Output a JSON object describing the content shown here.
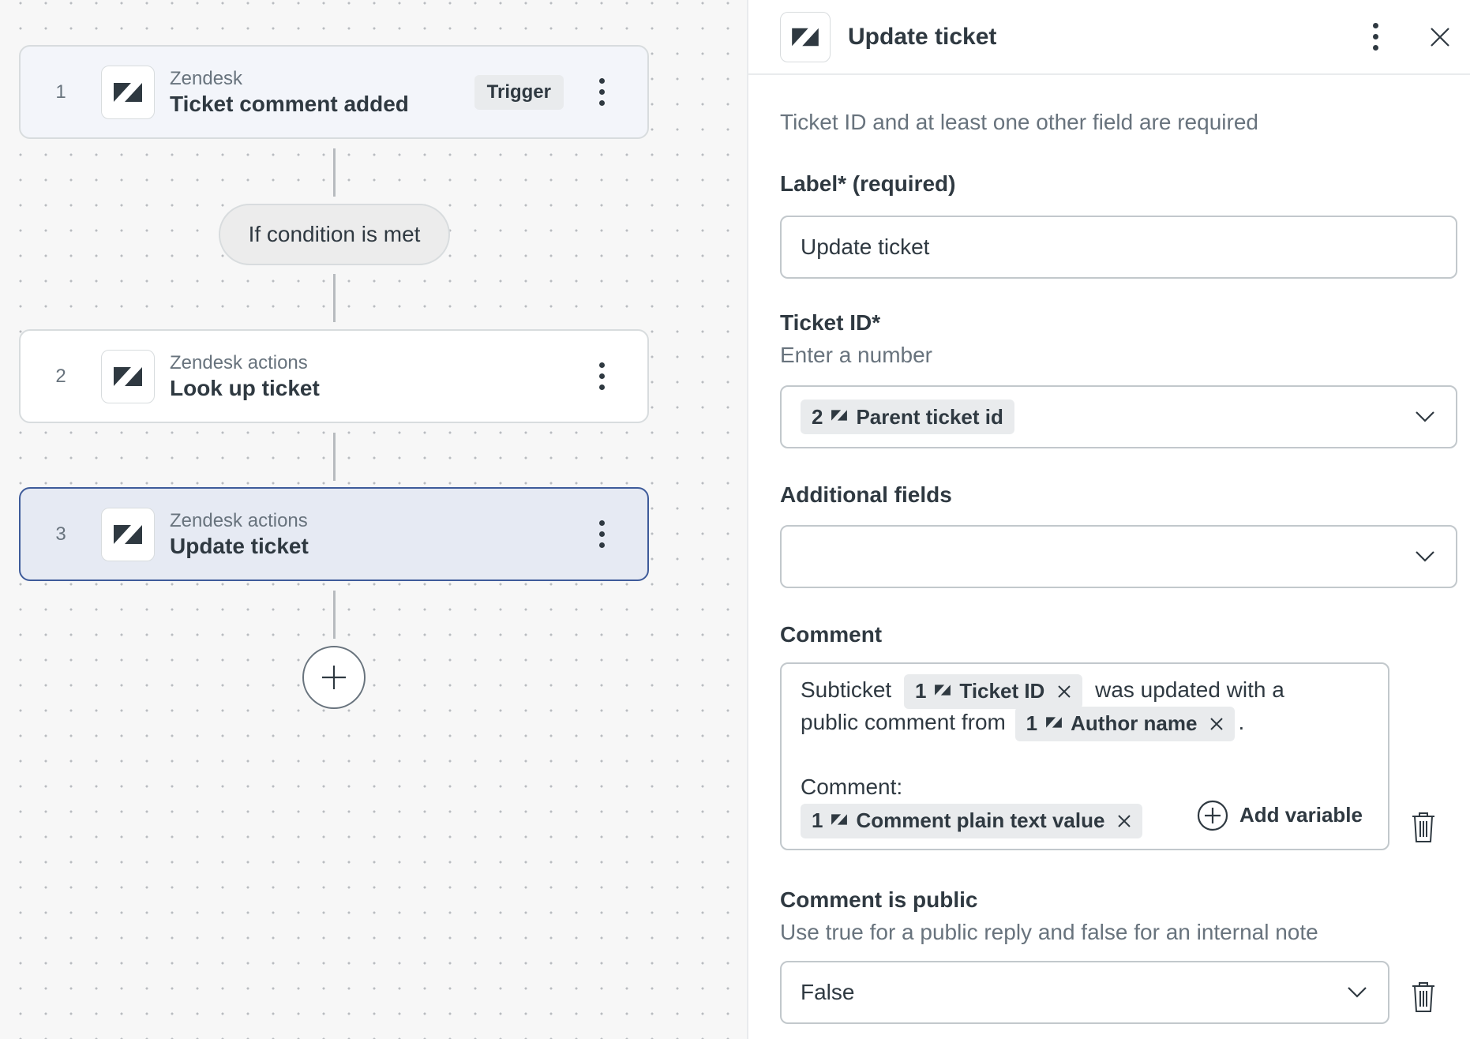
{
  "canvas": {
    "steps": [
      {
        "number": "1",
        "app": "Zendesk",
        "name": "Ticket comment added",
        "badge": "Trigger"
      },
      {
        "number": "2",
        "app": "Zendesk actions",
        "name": "Look up ticket"
      },
      {
        "number": "3",
        "app": "Zendesk actions",
        "name": "Update ticket"
      }
    ],
    "condition_label": "If condition is met"
  },
  "panel": {
    "title": "Update ticket",
    "hint": "Ticket ID and at least one other field are required",
    "label_field": {
      "label": "Label* (required)",
      "value": "Update ticket"
    },
    "ticket_id": {
      "label": "Ticket ID*",
      "sublabel": "Enter a number",
      "pill": {
        "step": "2",
        "text": "Parent ticket id"
      }
    },
    "additional_fields": {
      "label": "Additional fields",
      "value": ""
    },
    "comment": {
      "label": "Comment",
      "text1": "Subticket",
      "pill1": {
        "step": "1",
        "text": "Ticket ID"
      },
      "text2": "was updated with a",
      "text3": "public comment from",
      "pill2": {
        "step": "1",
        "text": "Author name"
      },
      "text4": ".",
      "text5": "Comment:",
      "pill3": {
        "step": "1",
        "text": "Comment plain text value"
      },
      "add_variable": "Add variable"
    },
    "comment_is_public": {
      "label": "Comment is public",
      "sublabel": "Use true for a public reply and false for an internal note",
      "value": "False"
    }
  },
  "colors": {
    "selected_border": "#3e5b9a",
    "selected_bg": "#e6eaf3",
    "text_primary": "#2f3941",
    "text_secondary": "#68737d"
  }
}
